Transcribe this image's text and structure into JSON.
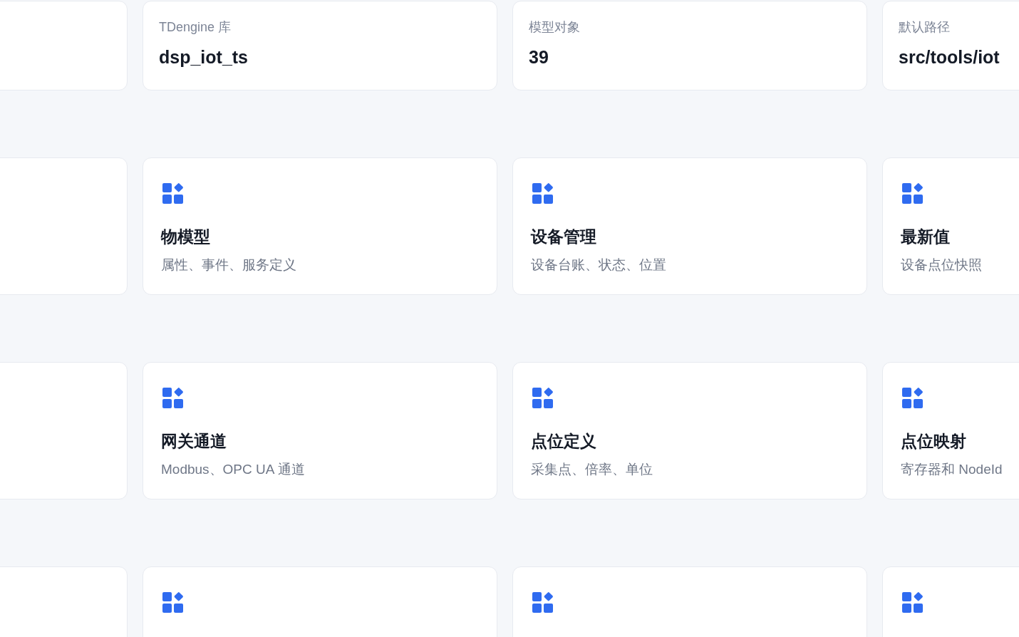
{
  "stats": [
    {
      "label": "TDengine 库",
      "value": "dsp_iot_ts"
    },
    {
      "label": "模型对象",
      "value": "39"
    },
    {
      "label": "默认路径",
      "value": "src/tools/iot"
    }
  ],
  "modules": [
    {
      "title": "物模型",
      "description": "属性、事件、服务定义"
    },
    {
      "title": "设备管理",
      "description": "设备台账、状态、位置"
    },
    {
      "title": "最新值",
      "description": "设备点位快照"
    },
    {
      "title": "网关通道",
      "description": "Modbus、OPC UA 通道"
    },
    {
      "title": "点位定义",
      "description": "采集点、倍率、单位"
    },
    {
      "title": "点位映射",
      "description": "寄存器和 NodeId"
    }
  ]
}
